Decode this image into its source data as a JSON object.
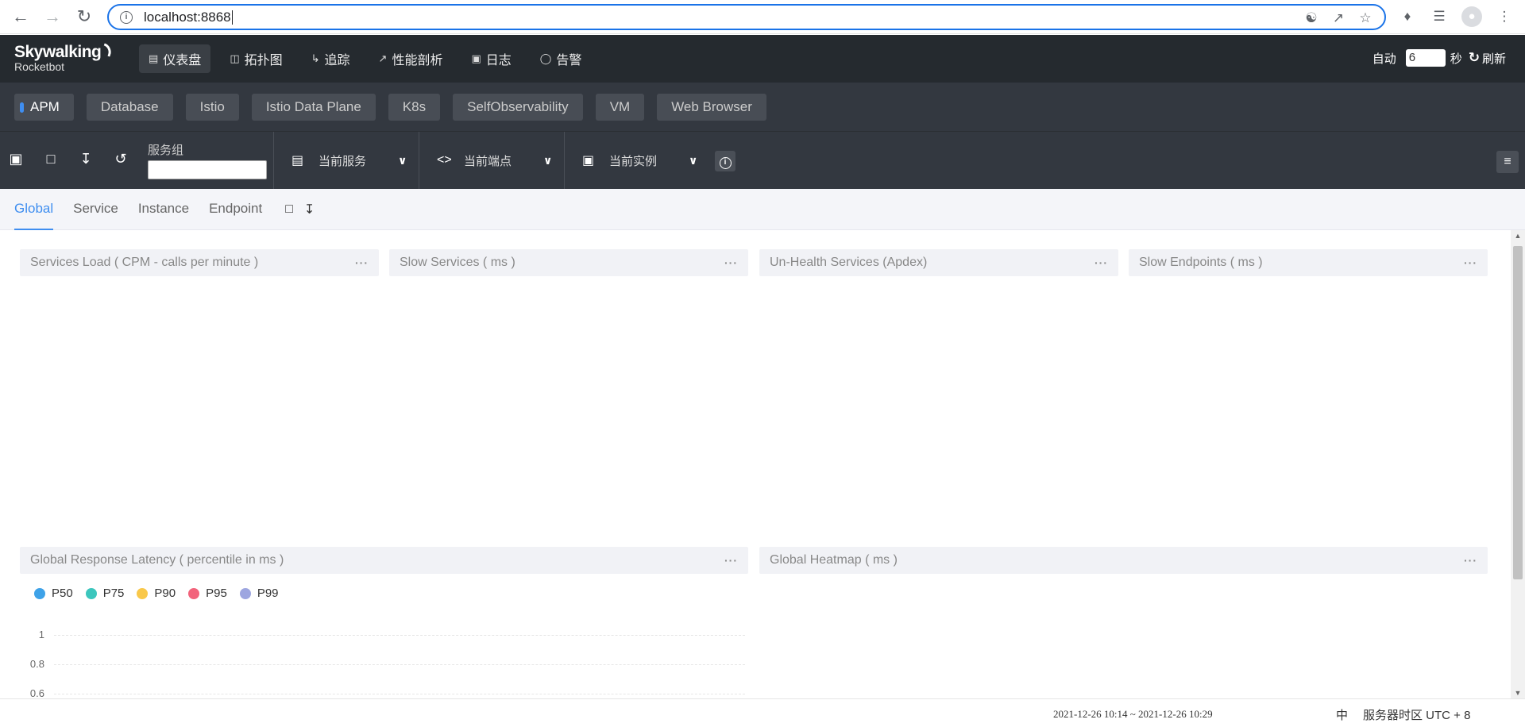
{
  "browser": {
    "url": "localhost:8868"
  },
  "header": {
    "logo_line1": "Skywalking",
    "logo_line2": "Rocketbot",
    "nav": [
      {
        "label": "仪表盘",
        "icon": "bar-chart-icon"
      },
      {
        "label": "拓扑图",
        "icon": "topology-icon"
      },
      {
        "label": "追踪",
        "icon": "trace-icon"
      },
      {
        "label": "性能剖析",
        "icon": "trend-icon"
      },
      {
        "label": "日志",
        "icon": "log-icon"
      },
      {
        "label": "告警",
        "icon": "alarm-icon"
      }
    ],
    "auto_label": "自动",
    "interval_value": "6",
    "seconds_label": "秒",
    "refresh_label": "刷新"
  },
  "layers": [
    "APM",
    "Database",
    "Istio",
    "Istio Data Plane",
    "K8s",
    "SelfObservability",
    "VM",
    "Web Browser"
  ],
  "toolbar": {
    "service_group_label": "服务组",
    "service_group_value": "",
    "current_service": "当前服务",
    "current_endpoint": "当前端点",
    "current_instance": "当前实例"
  },
  "dashboard_tabs": [
    "Global",
    "Service",
    "Instance",
    "Endpoint"
  ],
  "widgets": {
    "services_load": "Services Load ( CPM - calls per minute )",
    "slow_services": "Slow Services ( ms )",
    "unhealth_services": "Un-Health Services (Apdex)",
    "slow_endpoints": "Slow Endpoints ( ms )",
    "global_latency": "Global Response Latency ( percentile in ms )",
    "global_heatmap": "Global Heatmap ( ms )",
    "more": "···"
  },
  "chart_data": {
    "type": "line",
    "title": "Global Response Latency ( percentile in ms )",
    "series": [
      {
        "name": "P50",
        "color": "#3ea2e8",
        "values": []
      },
      {
        "name": "P75",
        "color": "#3cc6bd",
        "values": []
      },
      {
        "name": "P90",
        "color": "#f9c84a",
        "values": []
      },
      {
        "name": "P95",
        "color": "#f2637b",
        "values": []
      },
      {
        "name": "P99",
        "color": "#9da6e0",
        "values": []
      }
    ],
    "y_ticks": [
      "1",
      "0.8",
      "0.6"
    ],
    "legend_position": "top-left",
    "grid": true
  },
  "footer": {
    "time_range": "2021-12-26 10:14 ~ 2021-12-26 10:29",
    "lang": "中",
    "timezone": "服务器时区 UTC + 8"
  }
}
